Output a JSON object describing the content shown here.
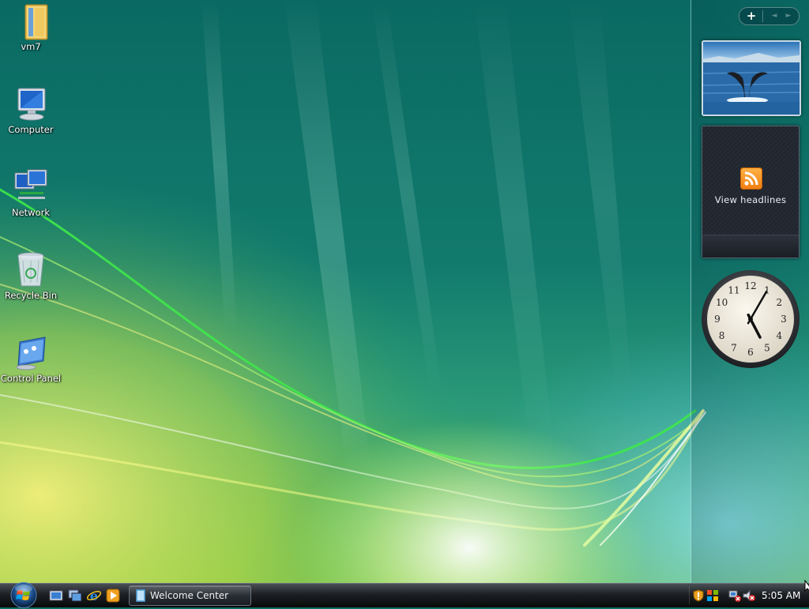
{
  "desktop": {
    "icons": [
      {
        "label": "vm7",
        "icon": "folder-icon"
      },
      {
        "label": "Computer",
        "icon": "computer-icon"
      },
      {
        "label": "Network",
        "icon": "network-icon"
      },
      {
        "label": "Recycle Bin",
        "icon": "recycle-bin-icon"
      },
      {
        "label": "Control Panel",
        "icon": "control-panel-icon"
      }
    ]
  },
  "sidebar": {
    "add_label": "+",
    "prev_label": "◄",
    "next_label": "►",
    "feeds": {
      "label": "View headlines",
      "icon": "rss-icon"
    },
    "clock": {
      "hour": 5,
      "minute": 5,
      "numerals": [
        "12",
        "1",
        "2",
        "3",
        "4",
        "5",
        "6",
        "7",
        "8",
        "9",
        "10",
        "11"
      ]
    }
  },
  "taskbar": {
    "start_icon": "windows-logo-icon",
    "quicklaunch": [
      "show-desktop-icon",
      "switch-windows-icon",
      "internet-explorer-icon",
      "media-player-icon"
    ],
    "tasks": [
      {
        "label": "Welcome Center",
        "icon": "welcome-center-icon"
      }
    ],
    "tray": {
      "icons": [
        "security-shield-icon",
        "windows-update-icon",
        "network-disconnected-icon",
        "volume-muted-icon"
      ]
    },
    "clock": "5:05 AM"
  },
  "colors": {
    "sidebar_border": "#b4e6f0",
    "taskbar": "#1c1f23",
    "rss": "#f07d10"
  }
}
